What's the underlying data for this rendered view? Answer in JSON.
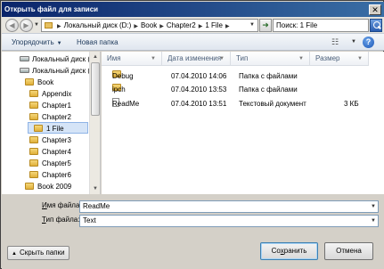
{
  "window": {
    "title": "Открыть файл для записи",
    "close_glyph": "✕"
  },
  "nav": {
    "back_glyph": "◀",
    "forward_glyph": "▶",
    "breadcrumb": [
      "Локальный диск (D:)",
      "Book",
      "Chapter2",
      "1 File"
    ],
    "search_placeholder": "Поиск: 1 File"
  },
  "toolbar": {
    "organize": "Упорядочить",
    "new_folder": "Новая папка"
  },
  "tree": [
    {
      "label": "Локальный диск (C",
      "type": "drive"
    },
    {
      "label": "Локальный диск (I",
      "type": "drive"
    },
    {
      "label": "Book",
      "type": "folder"
    },
    {
      "label": "Appendix",
      "type": "folder"
    },
    {
      "label": "Chapter1",
      "type": "folder"
    },
    {
      "label": "Chapter2",
      "type": "folder"
    },
    {
      "label": "1 File",
      "type": "folder",
      "selected": true
    },
    {
      "label": "Chapter3",
      "type": "folder"
    },
    {
      "label": "Chapter4",
      "type": "folder"
    },
    {
      "label": "Chapter5",
      "type": "folder"
    },
    {
      "label": "Chapter6",
      "type": "folder"
    },
    {
      "label": "Book 2009",
      "type": "folder"
    }
  ],
  "columns": {
    "name": "Имя",
    "date": "Дата изменения",
    "type": "Тип",
    "size": "Размер"
  },
  "files": [
    {
      "name": "Debug",
      "date": "07.04.2010 14:06",
      "type": "Папка с файлами",
      "size": "",
      "icon": "folder"
    },
    {
      "name": "ipch",
      "date": "07.04.2010 13:53",
      "type": "Папка с файлами",
      "size": "",
      "icon": "folder"
    },
    {
      "name": "ReadMe",
      "date": "07.04.2010 13:51",
      "type": "Текстовый документ",
      "size": "3 КБ",
      "icon": "document"
    }
  ],
  "form": {
    "filename_label_u": "И",
    "filename_label_rest": "мя файла:",
    "filename_value": "ReadMe",
    "filetype_label_u": "Т",
    "filetype_label_rest": "ип файла:",
    "filetype_value": "Text"
  },
  "buttons": {
    "hide_folders": "Скрыть папки",
    "save_u": "х",
    "save_pre": "Со",
    "save_post": "ранить",
    "cancel": "Отмена"
  }
}
